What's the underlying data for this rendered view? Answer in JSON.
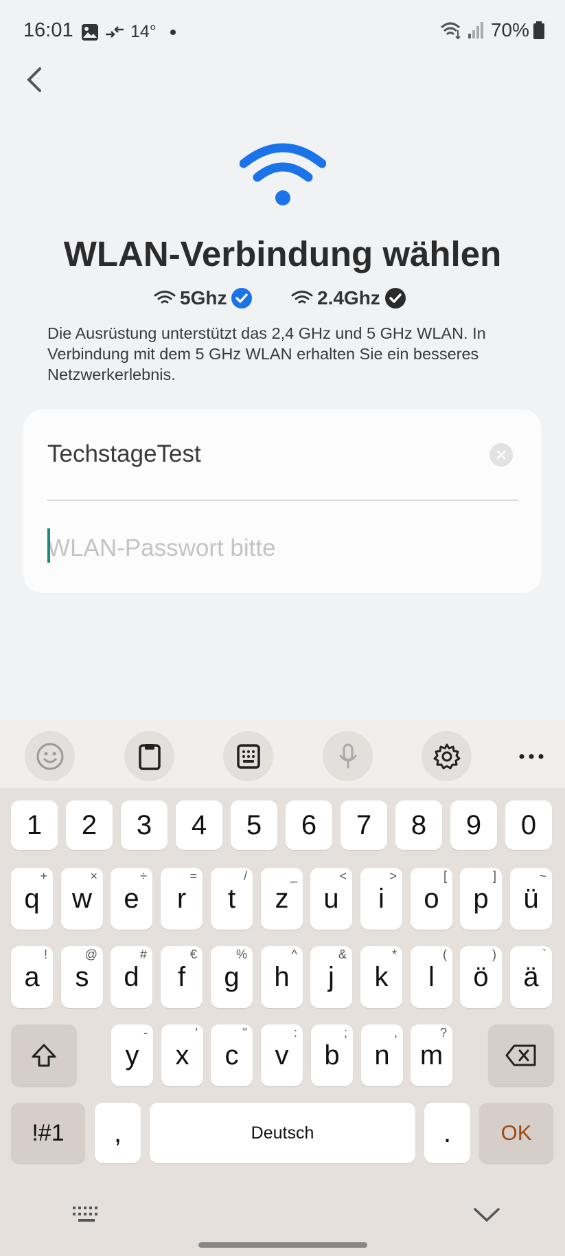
{
  "status": {
    "time": "16:01",
    "temperature": "14°",
    "battery": "70%",
    "icons": [
      "image-icon",
      "data-transfer-icon",
      "wifi-signal-icon",
      "cell-signal-icon",
      "battery-icon"
    ]
  },
  "header": {
    "back_icon": "chevron-left-icon",
    "hero_icon": "wifi-icon",
    "title": "WLAN-Verbindung wählen"
  },
  "bands": [
    {
      "label": "5Ghz",
      "check_color": "#1a73e8"
    },
    {
      "label": "2.4Ghz",
      "check_color": "#2b2b2b"
    }
  ],
  "description": "Die Ausrüstung unterstützt das 2,4 GHz und 5 GHz WLAN. In Verbindung mit dem 5 GHz WLAN erhalten Sie ein besseres Netzwerkerlebnis.",
  "form": {
    "ssid_value": "TechstageTest",
    "password_value": "",
    "password_placeholder": "WLAN-Passwort bitte"
  },
  "keyboard": {
    "toolbar": [
      "emoji-icon",
      "clipboard-icon",
      "keypad-icon",
      "microphone-icon",
      "gear-icon",
      "more-icon"
    ],
    "number_row": [
      "1",
      "2",
      "3",
      "4",
      "5",
      "6",
      "7",
      "8",
      "9",
      "0"
    ],
    "row1": [
      {
        "k": "q",
        "s": "+"
      },
      {
        "k": "w",
        "s": "×"
      },
      {
        "k": "e",
        "s": "÷"
      },
      {
        "k": "r",
        "s": "="
      },
      {
        "k": "t",
        "s": "/"
      },
      {
        "k": "z",
        "s": "_"
      },
      {
        "k": "u",
        "s": "<"
      },
      {
        "k": "i",
        "s": ">"
      },
      {
        "k": "o",
        "s": "["
      },
      {
        "k": "p",
        "s": "]"
      },
      {
        "k": "ü",
        "s": "~"
      }
    ],
    "row2": [
      {
        "k": "a",
        "s": "!"
      },
      {
        "k": "s",
        "s": "@"
      },
      {
        "k": "d",
        "s": "#"
      },
      {
        "k": "f",
        "s": "€"
      },
      {
        "k": "g",
        "s": "%"
      },
      {
        "k": "h",
        "s": "^"
      },
      {
        "k": "j",
        "s": "&"
      },
      {
        "k": "k",
        "s": "*"
      },
      {
        "k": "l",
        "s": "("
      },
      {
        "k": "ö",
        "s": ")"
      },
      {
        "k": "ä",
        "s": "`"
      }
    ],
    "row3": [
      {
        "k": "y",
        "s": "-"
      },
      {
        "k": "x",
        "s": "'"
      },
      {
        "k": "c",
        "s": "\""
      },
      {
        "k": "v",
        "s": ":"
      },
      {
        "k": "b",
        "s": ";"
      },
      {
        "k": "n",
        "s": ","
      },
      {
        "k": "m",
        "s": "?"
      }
    ],
    "symbols_label": "!#1",
    "comma": ",",
    "space_label": "Deutsch",
    "period": ".",
    "ok_label": "OK",
    "ok_color": "#9b4a12"
  },
  "navbar": {
    "icons": [
      "keyboard-icon",
      "chevron-down-icon"
    ]
  }
}
